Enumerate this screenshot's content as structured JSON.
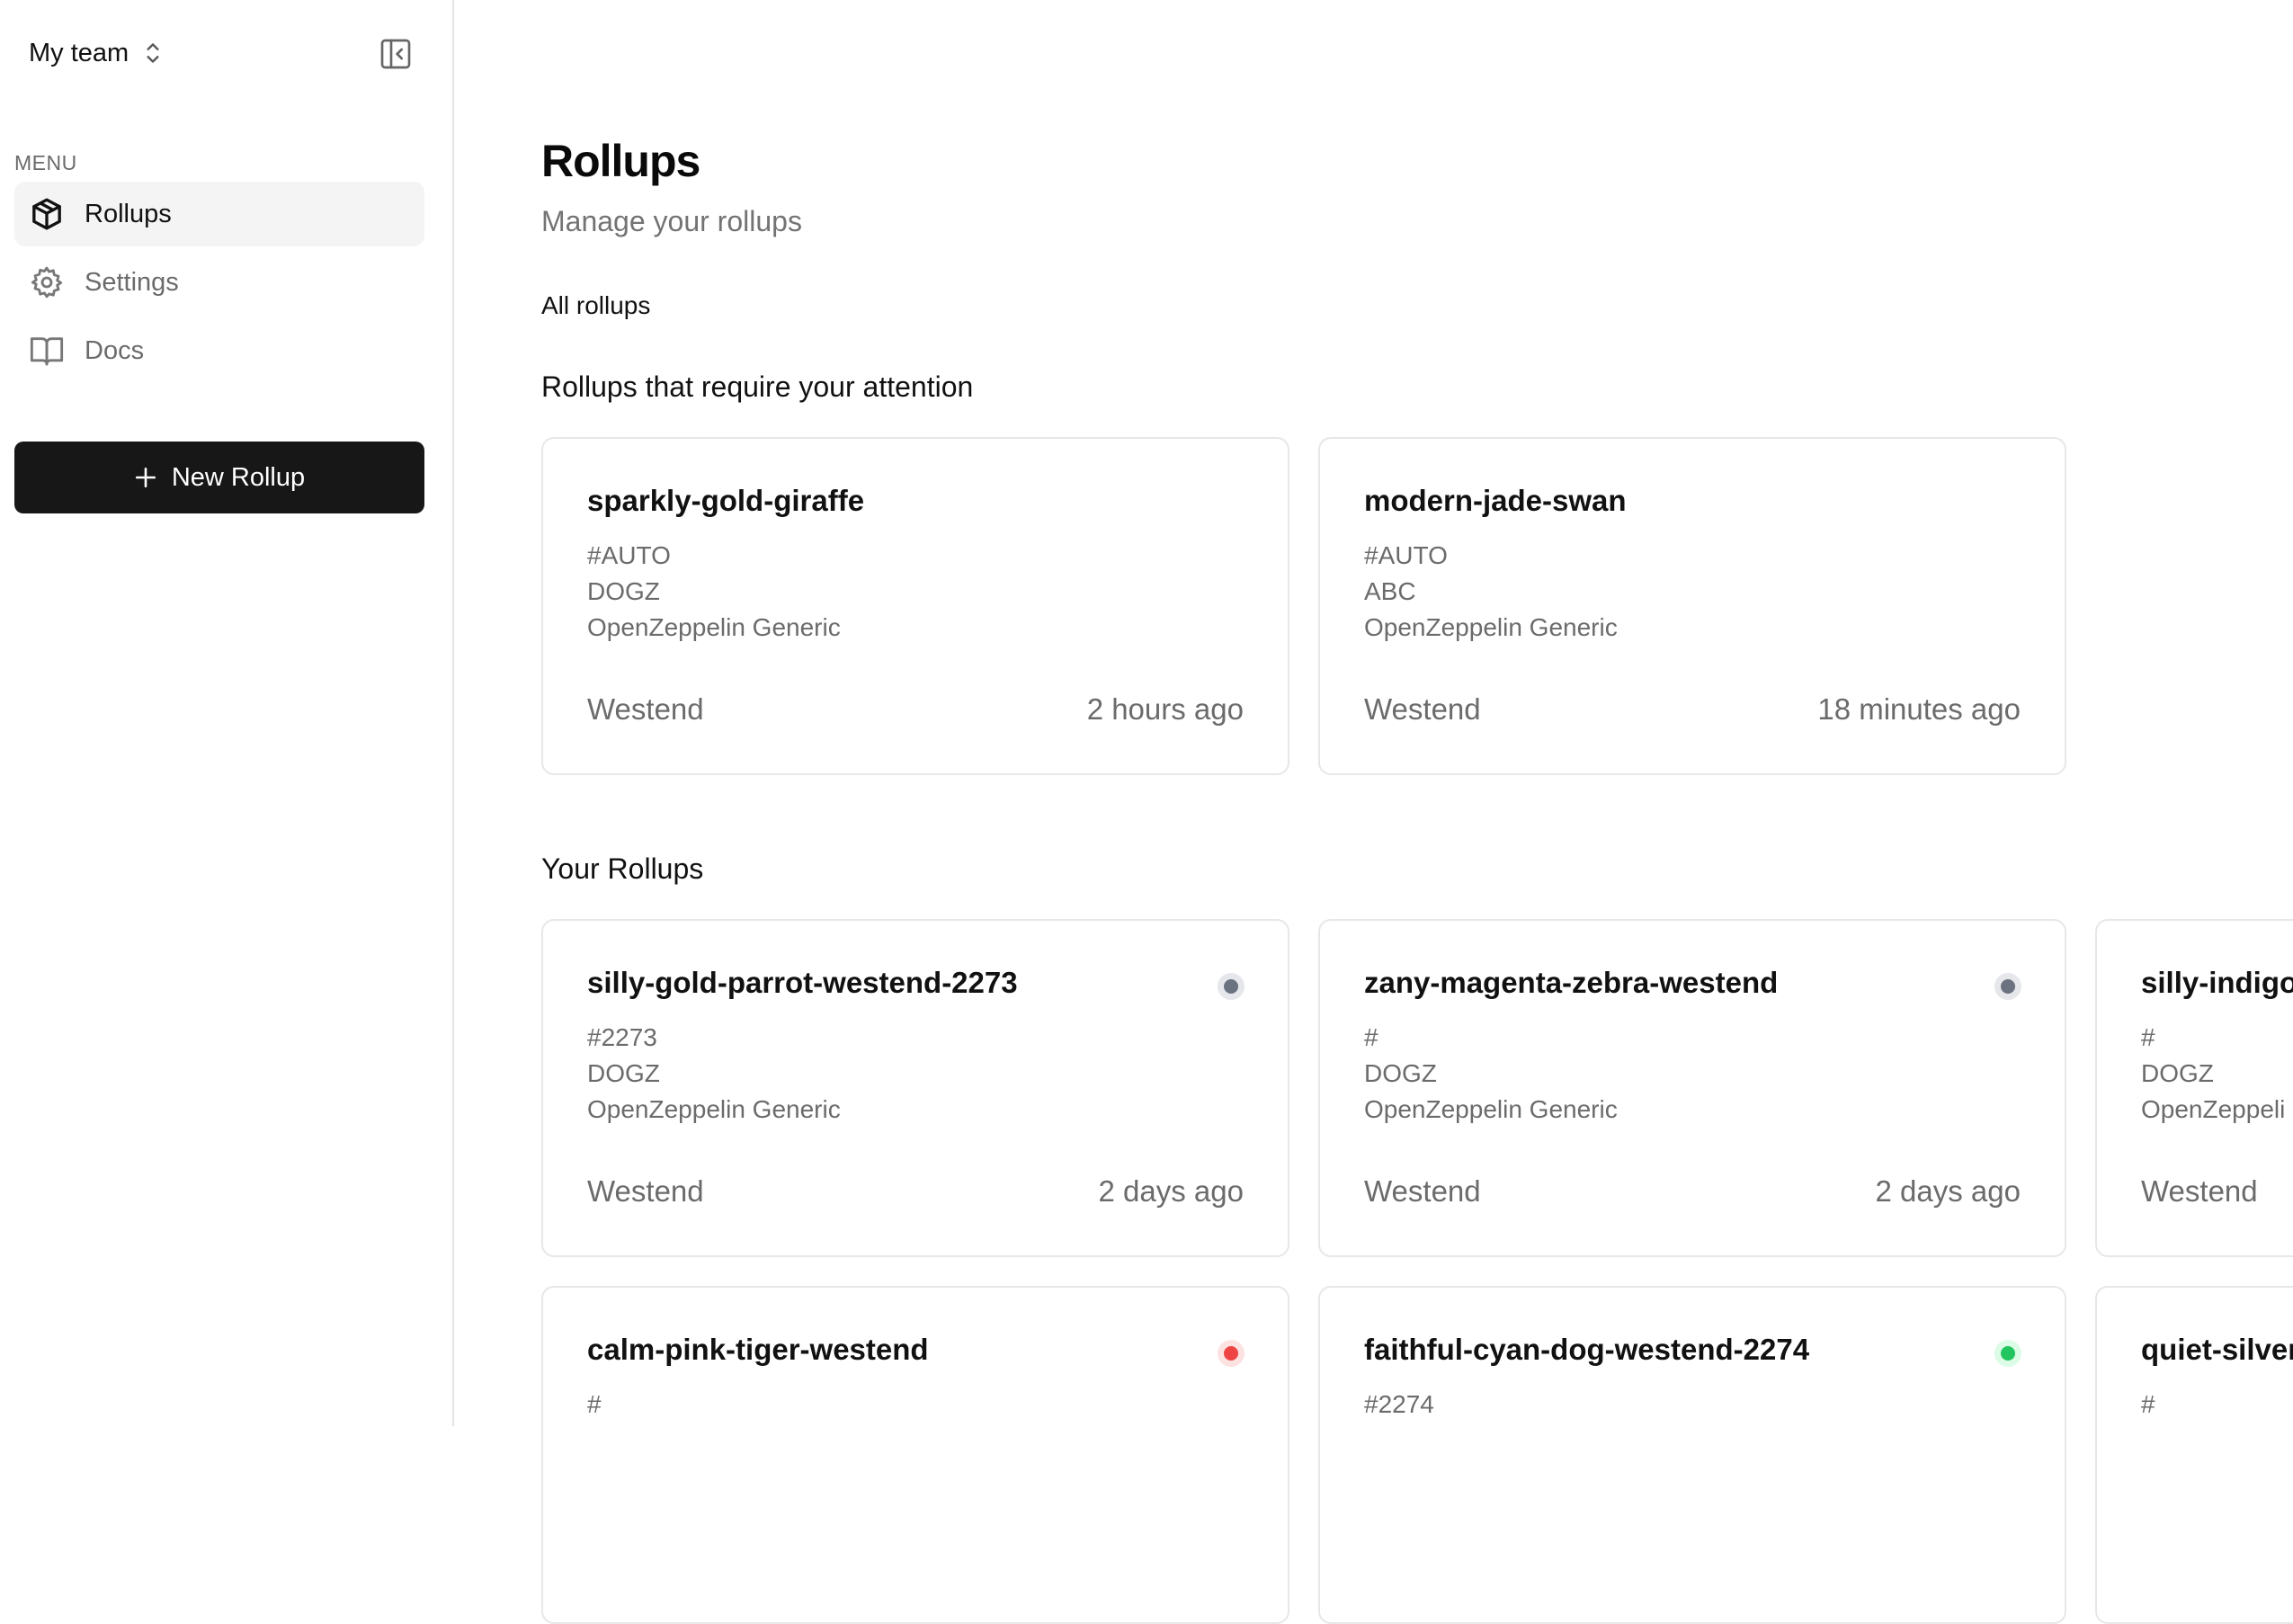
{
  "sidebar": {
    "team_name": "My team",
    "menu_label": "MENU",
    "items": [
      {
        "label": "Rollups",
        "icon": "package-icon",
        "active": true
      },
      {
        "label": "Settings",
        "icon": "gear-icon",
        "active": false
      },
      {
        "label": "Docs",
        "icon": "book-icon",
        "active": false
      }
    ],
    "new_button_label": "New Rollup"
  },
  "main": {
    "title": "Rollups",
    "subtitle": "Manage your rollups",
    "tab_all": "All rollups",
    "attention_title": "Rollups that require your attention",
    "your_title": "Your Rollups"
  },
  "attention_cards": [
    {
      "name": "sparkly-gold-giraffe",
      "id": "#AUTO",
      "token": "DOGZ",
      "template": "OpenZeppelin Generic",
      "network": "Westend",
      "time": "2 hours ago"
    },
    {
      "name": "modern-jade-swan",
      "id": "#AUTO",
      "token": "ABC",
      "template": "OpenZeppelin Generic",
      "network": "Westend",
      "time": "18 minutes ago"
    }
  ],
  "your_cards": [
    {
      "name": "silly-gold-parrot-westend-2273",
      "id": "#2273",
      "token": "DOGZ",
      "template": "OpenZeppelin Generic",
      "network": "Westend",
      "time": "2 days ago",
      "status": "gray"
    },
    {
      "name": "zany-magenta-zebra-westend",
      "id": "#",
      "token": "DOGZ",
      "template": "OpenZeppelin Generic",
      "network": "Westend",
      "time": "2 days ago",
      "status": "gray"
    },
    {
      "name": "silly-indigo",
      "id": "#",
      "token": "DOGZ",
      "template": "OpenZeppeli",
      "network": "Westend",
      "time": "",
      "status": "none"
    },
    {
      "name": "calm-pink-tiger-westend",
      "id": "#",
      "token": "",
      "template": "",
      "network": "",
      "time": "",
      "status": "red"
    },
    {
      "name": "faithful-cyan-dog-westend-2274",
      "id": "#2274",
      "token": "",
      "template": "",
      "network": "",
      "time": "",
      "status": "green"
    },
    {
      "name": "quiet-silver",
      "id": "#",
      "token": "",
      "template": "",
      "network": "",
      "time": "",
      "status": "none"
    }
  ],
  "colors": {
    "status_gray": "#6b7280",
    "status_gray_ring": "#e5e7eb",
    "status_red": "#ef4444",
    "status_red_ring": "#fde2e2",
    "status_green": "#22c55e",
    "status_green_ring": "#dcfce7",
    "button_bg": "#171717"
  }
}
